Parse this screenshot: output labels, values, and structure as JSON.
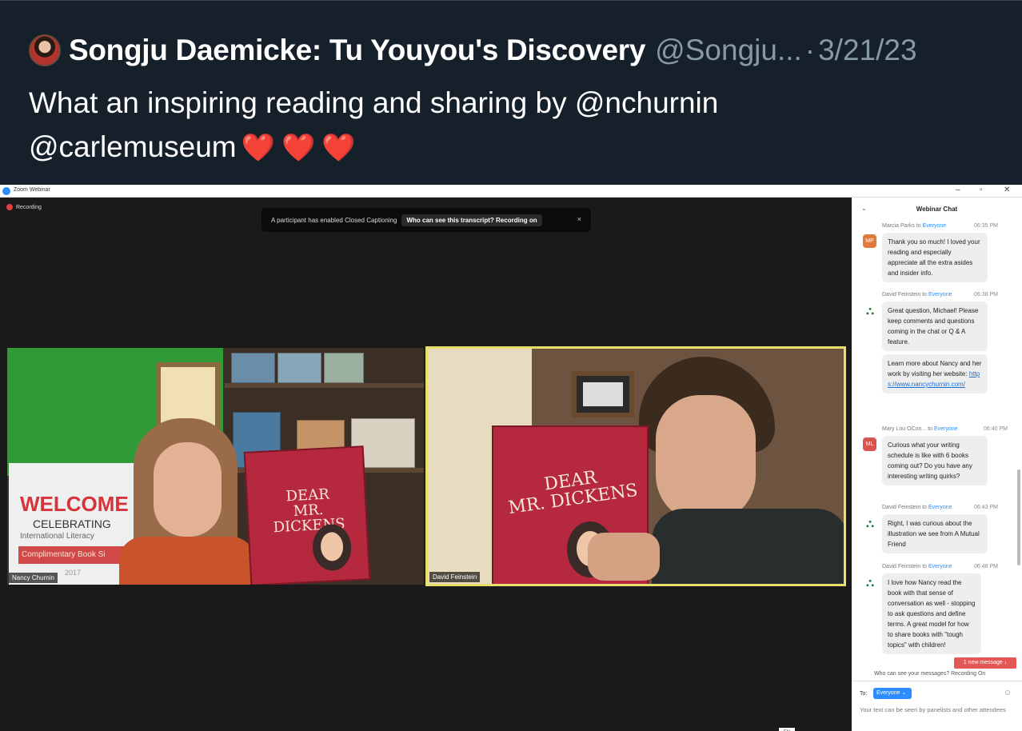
{
  "tweet": {
    "author": "Songju Daemicke: Tu Youyou's Discovery",
    "handle": "@Songju...",
    "separator": "·",
    "date": "3/21/23",
    "text_line1": "What an inspiring reading and sharing by @nchurnin",
    "text_line2": "@carlemuseum",
    "hearts": "❤️❤️❤️"
  },
  "zoom": {
    "title": "Zoom Webinar",
    "minimize": "–",
    "maximize": "▫",
    "close": "✕",
    "recording": "Recording",
    "cc_text": "A participant has enabled Closed Captioning",
    "cc_who": "Who can see this transcript? Recording on",
    "cc_close": "×",
    "participants": [
      {
        "name": "Nancy Churnin"
      },
      {
        "name": "David Feinstein"
      }
    ],
    "book_title_l1": "DEAR",
    "book_title_l2": "MR. DICKENS",
    "banner": {
      "welcome": "WELCOME",
      "celebrating": "CELEBRATING",
      "intl": "International Literacy",
      "complimentary": "Complimentary Book Si",
      "year": "2017"
    }
  },
  "chat": {
    "title": "Webinar Chat",
    "messages": [
      {
        "initials": "MP",
        "sender": "Marcia Parks",
        "to_word": "to",
        "recipient": "Everyone",
        "time": "06:35 PM",
        "text": "Thank you so much! I loved your reading and especially appreciate all the extra asides and insider info."
      },
      {
        "sender": "David Feinstein",
        "to_word": "to",
        "recipient": "Everyone",
        "time": "06:38 PM",
        "text": "Great question, Michael! Please keep comments and questions coming in the chat or Q & A feature.",
        "text2": "Learn more about Nancy and her work by visiting her website:",
        "link": "https://www.nancychurnin.com/"
      },
      {
        "initials": "ML",
        "sender": "Mary Lou OCon...",
        "to_word": "to",
        "recipient": "Everyone",
        "time": "06:40 PM",
        "text": "Curious what your writing schedule is like with 6 books coming out? Do you have any interesting writing quirks?"
      },
      {
        "sender": "David Feinstein",
        "to_word": "to",
        "recipient": "Everyone",
        "time": "06:43 PM",
        "text": "Right, I was curious about the illustration we see from A Mutual Friend"
      },
      {
        "sender": "David Feinstein",
        "to_word": "to",
        "recipient": "Everyone",
        "time": "06:48 PM",
        "text": "I love how Nancy read the book with that sense of conversation as well - stopping to ask questions and define terms. A great model for how to share books with \"tough topics\" with children!"
      }
    ],
    "new_message": "1 new message ↓",
    "who_can_see": "Who can see your messages? Recording On",
    "to_label": "To:",
    "to_value": "Everyone ⌄",
    "compose_placeholder": "Your text can be seen by panelists and other attendees",
    "lang": "EN"
  },
  "colors": {
    "tweet_bg": "#15202b",
    "zoom_blue": "#2d8cff",
    "heart": "#e0245e",
    "active_speaker": "#e8e06a"
  }
}
